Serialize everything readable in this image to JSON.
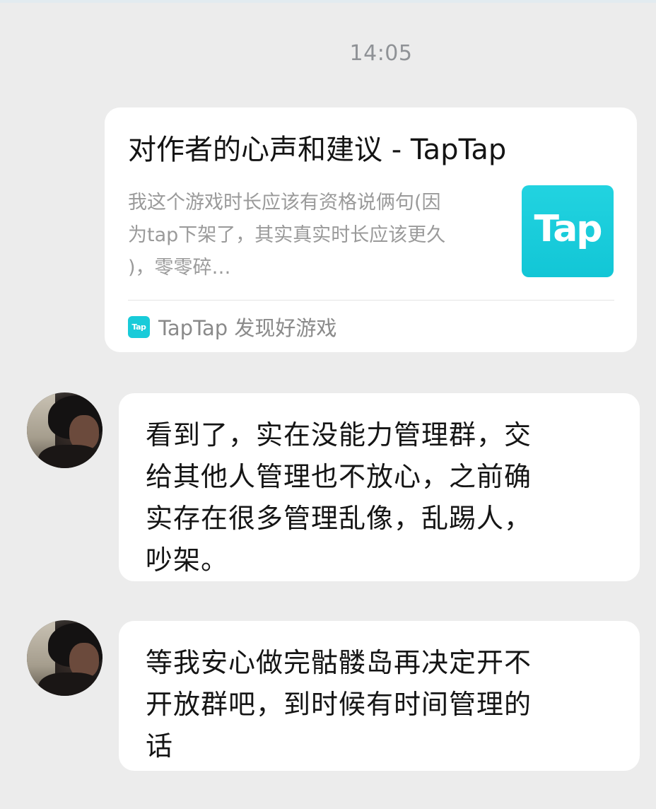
{
  "timestamp": "14:05",
  "link_card": {
    "title": "对作者的心声和建议 - TapTap",
    "description_lines": [
      "我这个游戏时长应该有资格说俩句(因",
      "为tap下架了，其实真实时长应该更久",
      ")，零零碎…"
    ],
    "logo_text": "Tap",
    "source_logo_text": "Tap",
    "source": "TapTap 发现好游戏"
  },
  "messages": [
    {
      "lines": [
        "看到了，实在没能力管理群，交",
        "给其他人管理也不放心，之前确",
        "实存在很多管理乱像，乱踢人，",
        "吵架。"
      ]
    },
    {
      "lines": [
        "等我安心做完骷髅岛再决定开不",
        "开放群吧，到时候有时间管理的",
        "话"
      ]
    }
  ]
}
